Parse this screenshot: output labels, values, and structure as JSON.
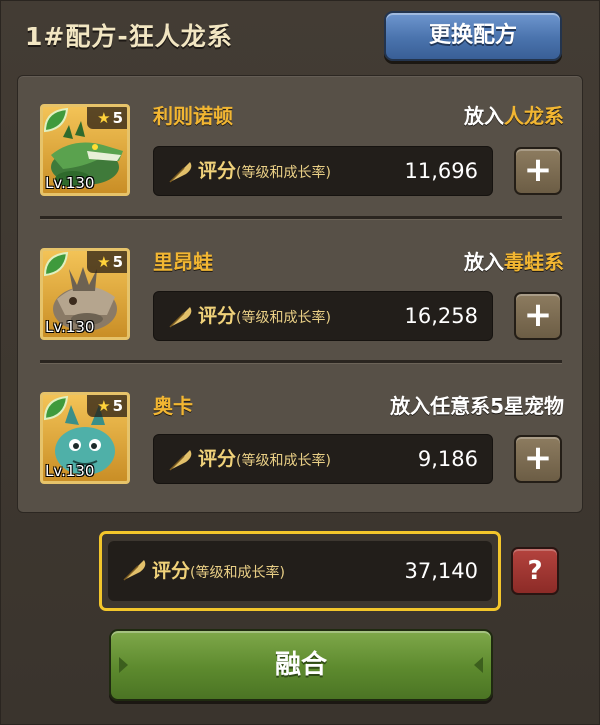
{
  "header": {
    "title": "1#配方-狂人龙系",
    "change_button": "更换配方"
  },
  "score_label": "评分",
  "score_sublabel": "(等级和成长率)",
  "place_prefix": "放入",
  "pets": [
    {
      "name": "利则诺顿",
      "stars": "5",
      "level": "Lv.130",
      "place_target": "人龙系",
      "score": "11,696",
      "add": "+",
      "art": "crocodile-dragon-sprite"
    },
    {
      "name": "里昂蛙",
      "stars": "5",
      "level": "Lv.130",
      "place_target": "毒蛙系",
      "score": "16,258",
      "add": "+",
      "art": "armored-frog-sprite"
    },
    {
      "name": "奥卡",
      "stars": "5",
      "level": "Lv.130",
      "place_plain": "放入任意系5星宠物",
      "score": "9,186",
      "add": "+",
      "art": "teal-lizard-sprite"
    }
  ],
  "total": {
    "score": "37,140",
    "help": "?"
  },
  "fuse_button": "融合",
  "colors": {
    "gold_text": "#f2b632",
    "blue_button": "#4a73ad",
    "green_button": "#5d8a2e",
    "red_button": "#8c2b27",
    "highlight_border": "#f3c62b"
  }
}
